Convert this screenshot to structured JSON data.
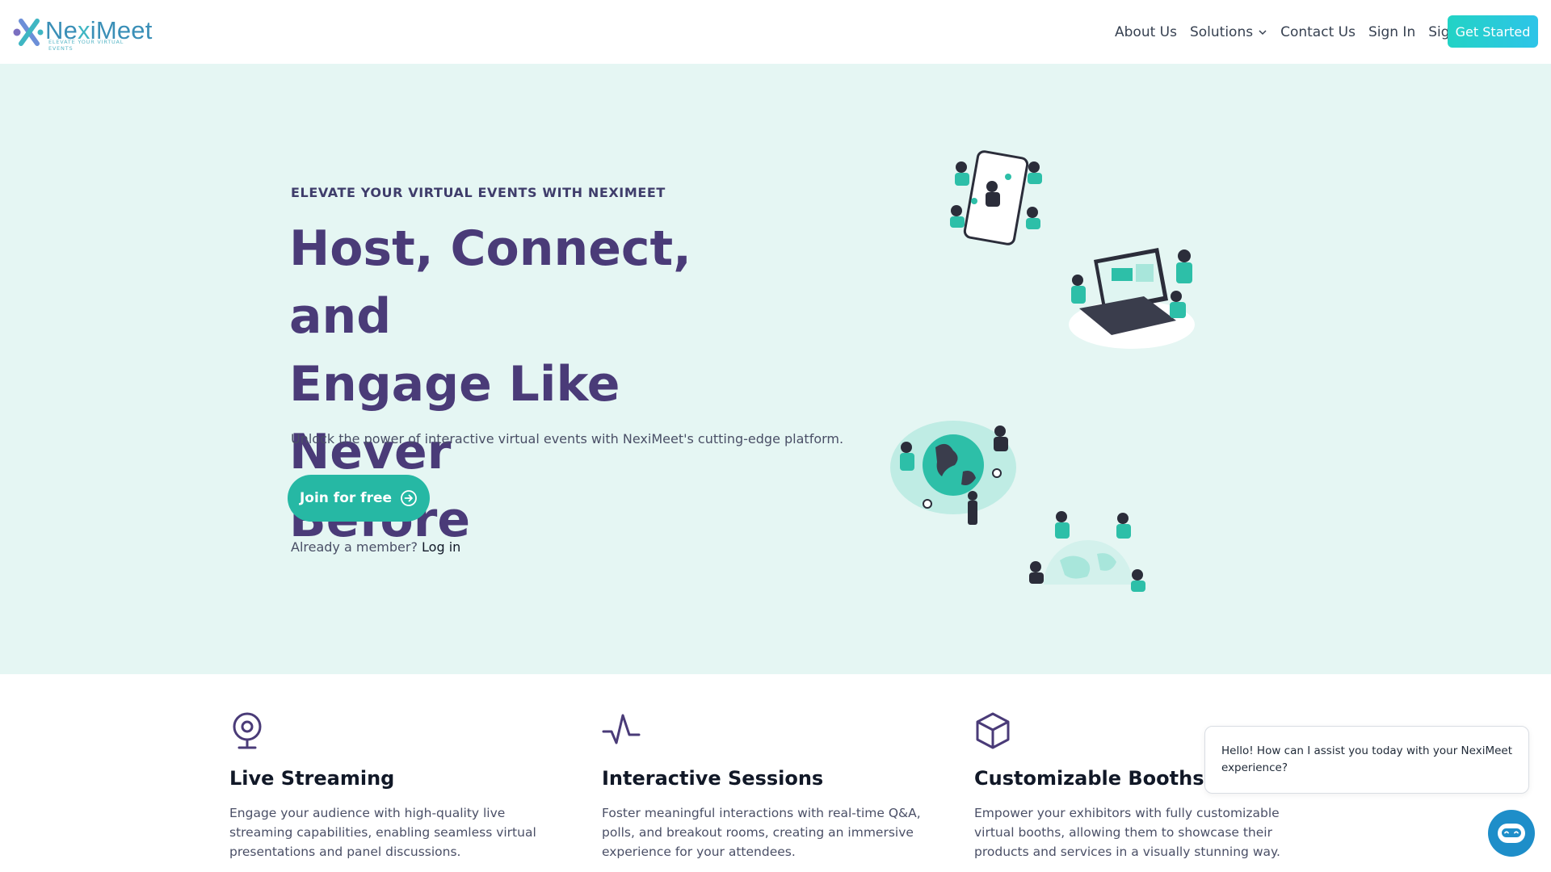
{
  "brand": {
    "name_part1": "Ne",
    "name_part2": "iMeet",
    "tagline": "ELEVATE YOUR VIRTUAL EVENTS",
    "colors": {
      "primary": "#3a8fb7",
      "accent": "#26b8a4",
      "purple": "#4a3b78"
    }
  },
  "nav": {
    "items": [
      {
        "label": "About Us"
      },
      {
        "label": "Solutions",
        "icon": "chevron-down-icon"
      },
      {
        "label": "Contact Us"
      },
      {
        "label": "Sign In"
      },
      {
        "label": "Sign Up"
      }
    ],
    "cta": "Get Started"
  },
  "hero": {
    "eyebrow": "ELEVATE YOUR VIRTUAL EVENTS WITH NEXIMEET",
    "headline_line1": "Host, Connect, and",
    "headline_line2": "Engage Like Never",
    "headline_line3": "Before",
    "subcopy": "Unlock the power of interactive virtual events with NexiMeet's cutting-edge platform.",
    "join_label": "Join for free",
    "member_text": "Already a member?",
    "login_label": "Log in",
    "background": "#e5f6f3"
  },
  "features": [
    {
      "icon": "webcam-icon",
      "title": "Live Streaming",
      "description": "Engage your audience with high-quality live streaming capabilities, enabling seamless virtual presentations and panel discussions."
    },
    {
      "icon": "activity-icon",
      "title": "Interactive Sessions",
      "description": "Foster meaningful interactions with real-time Q&A, polls, and breakout rooms, creating an immersive experience for your attendees."
    },
    {
      "icon": "box-icon",
      "title": "Customizable Booths",
      "description": "Empower your exhibitors with fully customizable virtual booths, allowing them to showcase their products and services in a visually stunning way."
    }
  ],
  "chat": {
    "message": "Hello! How can I assist you today with your NexiMeet experience?",
    "launcher_icon": "chatbot-icon"
  }
}
